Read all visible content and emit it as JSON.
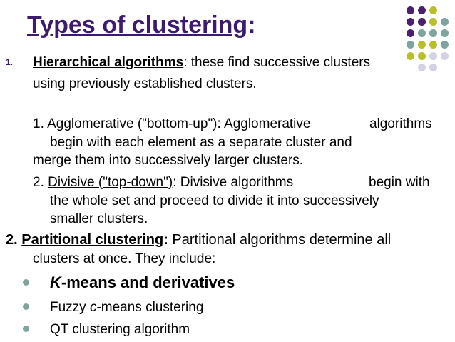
{
  "title": {
    "main": "Types of clustering",
    "colon": ":"
  },
  "hierarchical": {
    "number": "1.",
    "term": "Hierarchical algorithms",
    "rest": ": these find successive clusters",
    "line2": "using previously established clusters."
  },
  "agglomerative": {
    "number": "1.",
    "term": "Agglomerative (\"bottom-up\")",
    "rest_a": ": Agglomerative",
    "rest_b": "algorithms",
    "line2": "begin with each element as a separate cluster and",
    "line3": "merge them into successively larger clusters."
  },
  "divisive": {
    "number": "2.",
    "term": "Divisive (\"top-down\")",
    "rest_a": ": Divisive algorithms",
    "rest_b": "begin with",
    "line2": "the whole set and proceed to divide it into successively",
    "line3": "smaller clusters."
  },
  "partitional": {
    "number": "2.",
    "term": "Partitional clustering",
    "colon": ":",
    "rest": " Partitional algorithms determine all",
    "line2": "clusters at once.  They include:"
  },
  "bullets": {
    "kmeans_k": "K",
    "kmeans_rest": "-means and derivatives",
    "fuzzy_a": "Fuzzy ",
    "fuzzy_c": "c",
    "fuzzy_b": "-means clustering",
    "qt": "QT clustering algorithm"
  },
  "colors": {
    "purple": "#4b1f6b",
    "olive": "#b9bf2a",
    "teal": "#7da49e",
    "lavender": "#d3d1e6"
  }
}
